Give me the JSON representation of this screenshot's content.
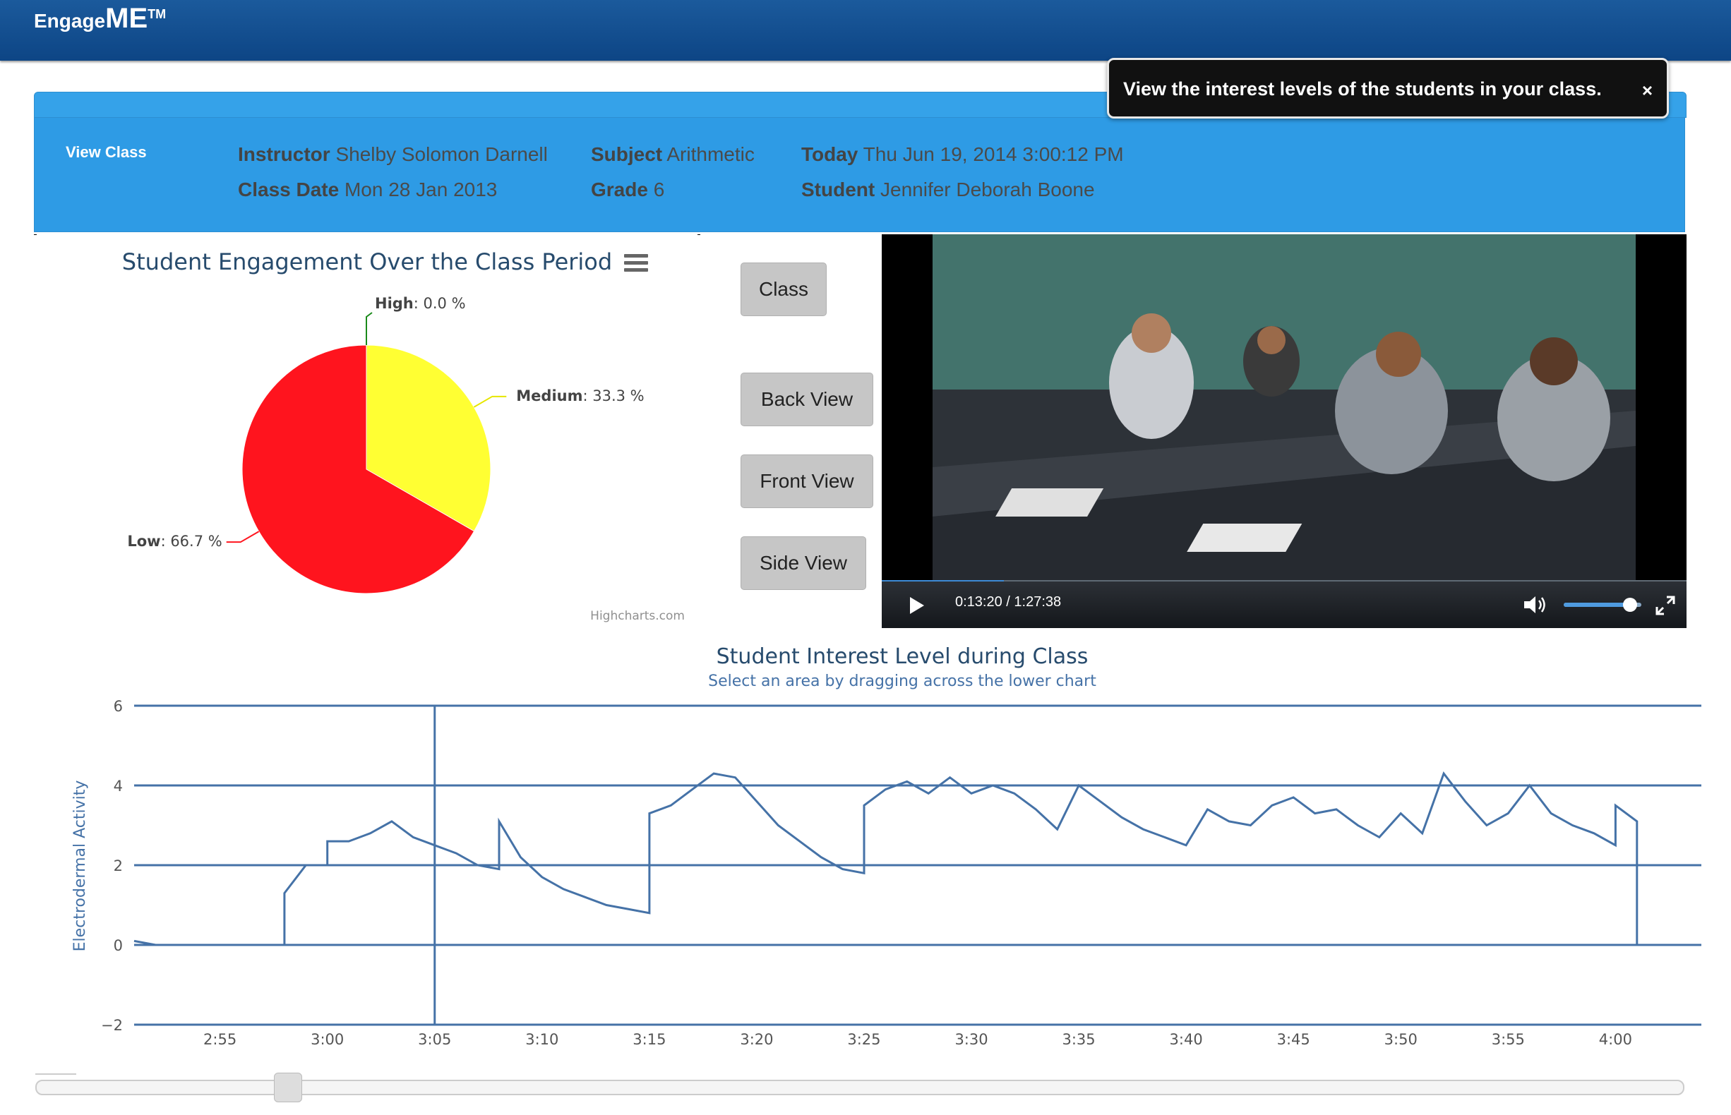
{
  "brand": {
    "part1": "Engage",
    "part2": "ME",
    "part3": "TM"
  },
  "tooltip": {
    "text": "View the interest levels of the students in your class.",
    "close": "×"
  },
  "panel": {
    "view_class": "View Class",
    "instructor_label": "Instructor",
    "instructor": "Shelby Solomon Darnell",
    "class_date_label": "Class Date",
    "class_date": "Mon 28 Jan 2013",
    "subject_label": "Subject",
    "subject": "Arithmetic",
    "grade_label": "Grade",
    "grade": "6",
    "today_label": "Today",
    "today": "Thu Jun 19, 2014 3:00:12 PM",
    "student_label": "Student",
    "student": "Jennifer Deborah Boone"
  },
  "view_buttons": {
    "class": "Class",
    "back": "Back View",
    "front": "Front View",
    "side": "Side View"
  },
  "video": {
    "time": "0:13:20 / 1:27:38",
    "progress": 0.152,
    "volume": 0.85
  },
  "colors": {
    "accent": "#2e9be5",
    "navbar": "#0d4585",
    "line": "#4572a7",
    "high": "#2ecc40",
    "medium": "#ffff33",
    "low": "#ff1a1a"
  },
  "chart_data": [
    {
      "type": "pie",
      "title": "Student Engagement Over the Class Period",
      "credits": "Highcharts.com",
      "slices": [
        {
          "name": "High",
          "value": 0.0,
          "label": "0.0 %",
          "color": "#1a8a1a"
        },
        {
          "name": "Medium",
          "value": 33.3,
          "label": "33.3 %",
          "color": "#ffff33"
        },
        {
          "name": "Low",
          "value": 66.7,
          "label": "66.7 %",
          "color": "#ff141e"
        }
      ]
    },
    {
      "type": "line",
      "title": "Student Interest Level during Class",
      "subtitle": "Select an area by dragging across the lower chart",
      "ylabel": "Electrodermal Activity",
      "ylim": [
        -2,
        6
      ],
      "yticks": [
        6,
        4,
        2,
        0,
        -2
      ],
      "xlim": [
        "2:51",
        "4:04"
      ],
      "xticks": [
        "2:55",
        "3:00",
        "3:05",
        "3:10",
        "3:15",
        "3:20",
        "3:25",
        "3:30",
        "3:35",
        "3:40",
        "3:45",
        "3:50",
        "3:55",
        "4:00"
      ],
      "crosshair_x": "3:05",
      "series": [
        {
          "points": [
            [
              "2:51",
              0.1
            ],
            [
              "2:52",
              0.0
            ],
            [
              "2:58",
              0.0
            ],
            [
              "2:58",
              1.3
            ],
            [
              "2:59",
              2.0
            ],
            [
              "3:00",
              2.0
            ],
            [
              "3:00",
              2.6
            ],
            [
              "3:01",
              2.6
            ],
            [
              "3:02",
              2.8
            ],
            [
              "3:03",
              3.1
            ],
            [
              "3:04",
              2.7
            ],
            [
              "3:05",
              2.5
            ],
            [
              "3:06",
              2.3
            ],
            [
              "3:07",
              2.0
            ],
            [
              "3:08",
              1.9
            ],
            [
              "3:08",
              3.1
            ],
            [
              "3:09",
              2.2
            ],
            [
              "3:10",
              1.7
            ],
            [
              "3:11",
              1.4
            ],
            [
              "3:12",
              1.2
            ],
            [
              "3:13",
              1.0
            ],
            [
              "3:14",
              0.9
            ],
            [
              "3:15",
              0.8
            ],
            [
              "3:15",
              3.3
            ],
            [
              "3:16",
              3.5
            ],
            [
              "3:17",
              3.9
            ],
            [
              "3:18",
              4.3
            ],
            [
              "3:19",
              4.2
            ],
            [
              "3:20",
              3.6
            ],
            [
              "3:21",
              3.0
            ],
            [
              "3:22",
              2.6
            ],
            [
              "3:23",
              2.2
            ],
            [
              "3:24",
              1.9
            ],
            [
              "3:25",
              1.8
            ],
            [
              "3:25",
              3.5
            ],
            [
              "3:26",
              3.9
            ],
            [
              "3:27",
              4.1
            ],
            [
              "3:28",
              3.8
            ],
            [
              "3:29",
              4.2
            ],
            [
              "3:30",
              3.8
            ],
            [
              "3:31",
              4.0
            ],
            [
              "3:32",
              3.8
            ],
            [
              "3:33",
              3.4
            ],
            [
              "3:34",
              2.9
            ],
            [
              "3:35",
              4.0
            ],
            [
              "3:36",
              3.6
            ],
            [
              "3:37",
              3.2
            ],
            [
              "3:38",
              2.9
            ],
            [
              "3:39",
              2.7
            ],
            [
              "3:40",
              2.5
            ],
            [
              "3:41",
              3.4
            ],
            [
              "3:42",
              3.1
            ],
            [
              "3:43",
              3.0
            ],
            [
              "3:44",
              3.5
            ],
            [
              "3:45",
              3.7
            ],
            [
              "3:46",
              3.3
            ],
            [
              "3:47",
              3.4
            ],
            [
              "3:48",
              3.0
            ],
            [
              "3:49",
              2.7
            ],
            [
              "3:50",
              3.3
            ],
            [
              "3:51",
              2.8
            ],
            [
              "3:52",
              4.3
            ],
            [
              "3:53",
              3.6
            ],
            [
              "3:54",
              3.0
            ],
            [
              "3:55",
              3.3
            ],
            [
              "3:56",
              4.0
            ],
            [
              "3:57",
              3.3
            ],
            [
              "3:58",
              3.0
            ],
            [
              "3:59",
              2.8
            ],
            [
              "4:00",
              2.5
            ],
            [
              "4:00",
              3.5
            ],
            [
              "4:01",
              3.1
            ],
            [
              "4:01",
              0.0
            ],
            [
              "4:03",
              0.0
            ]
          ]
        }
      ]
    }
  ]
}
